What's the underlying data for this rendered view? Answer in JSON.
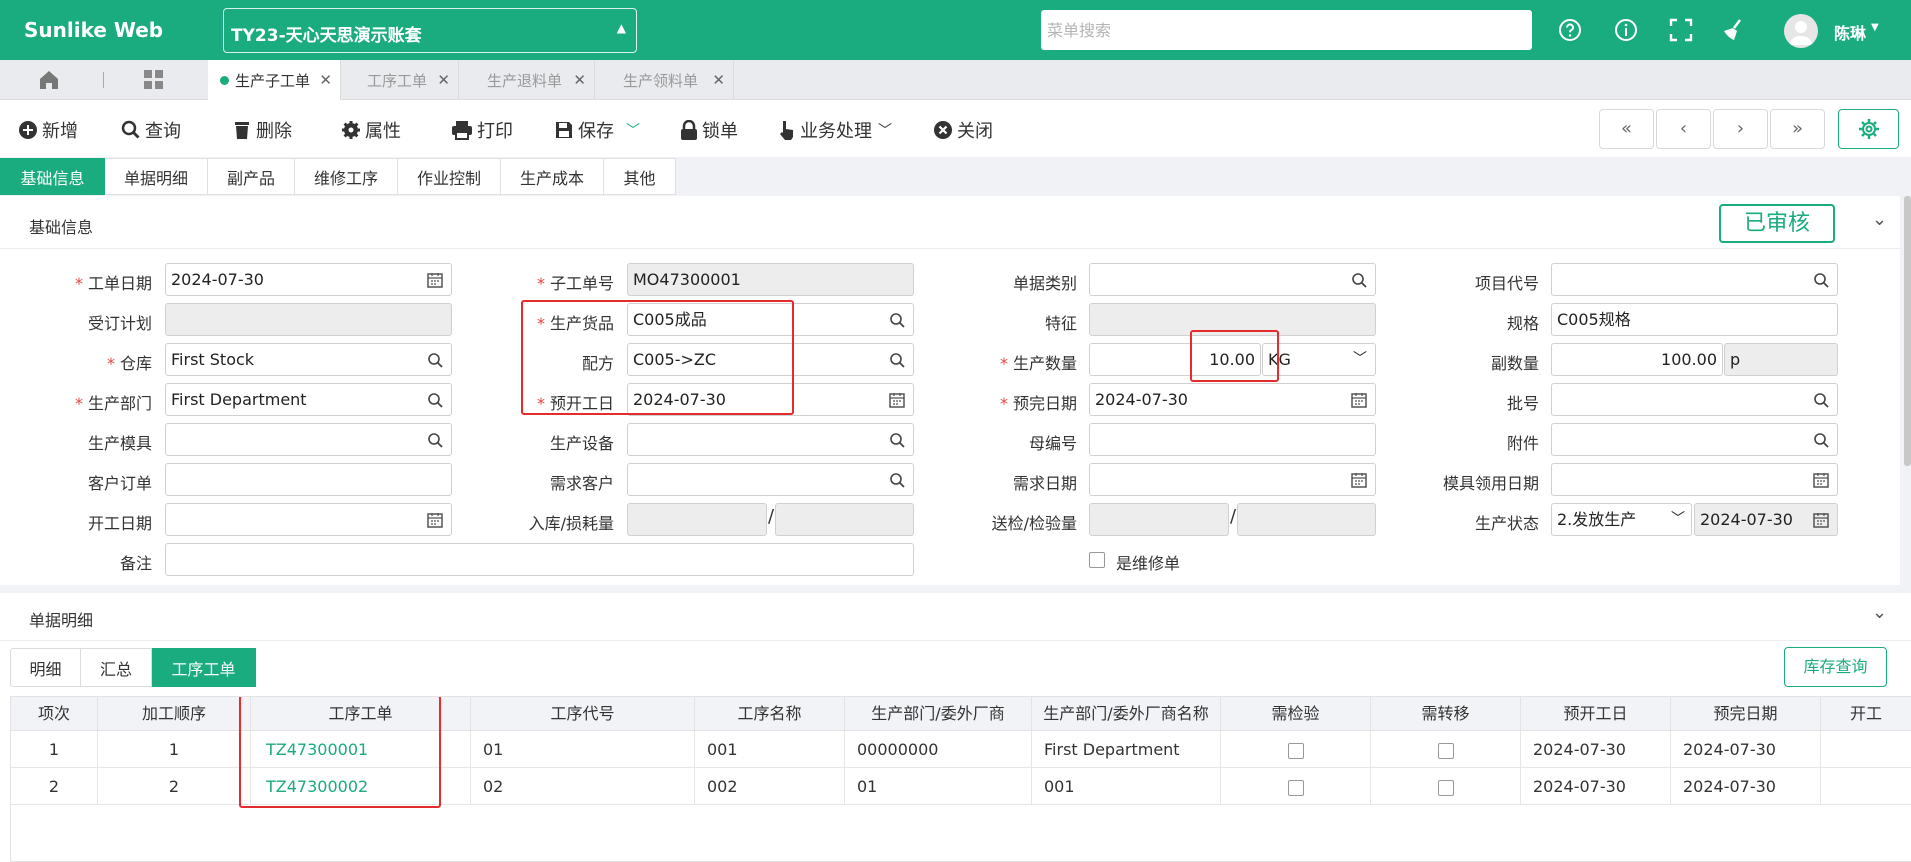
{
  "app": {
    "title": "Sunlike Web",
    "account": "TY23-天心天思演示账套",
    "menu_search_placeholder": "菜单搜索",
    "user": "陈琳"
  },
  "topbar_icons": [
    "help-icon",
    "info-icon",
    "fullscreen-icon",
    "clean-icon"
  ],
  "doc_tabs": [
    {
      "label": "生产子工单",
      "active": true
    },
    {
      "label": "工序工单",
      "active": false
    },
    {
      "label": "生产退料单",
      "active": false
    },
    {
      "label": "生产领料单",
      "active": false
    }
  ],
  "toolbar": {
    "add": "新增",
    "query": "查询",
    "delete": "删除",
    "props": "属性",
    "print": "打印",
    "save": "保存",
    "lock": "锁单",
    "business": "业务处理",
    "close": "关闭"
  },
  "section_tabs": [
    "基础信息",
    "单据明细",
    "副产品",
    "维修工序",
    "作业控制",
    "生产成本",
    "其他"
  ],
  "basic": {
    "header": "基础信息",
    "status_stamp": "已审核",
    "labels": {
      "order_date": "工单日期",
      "order_plan": "受订计划",
      "warehouse": "仓库",
      "dept": "生产部门",
      "mold": "生产模具",
      "customer_order": "客户订单",
      "start_date": "开工日期",
      "remark": "备注",
      "sub_order_no": "子工单号",
      "product": "生产货品",
      "recipe": "配方",
      "plan_start": "预开工日",
      "equipment": "生产设备",
      "demand_customer": "需求客户",
      "in_loss_qty": "入库/损耗量",
      "doc_type": "单据类别",
      "feature": "特征",
      "prod_qty": "生产数量",
      "plan_end": "预完日期",
      "mother_no": "母编号",
      "demand_date": "需求日期",
      "inspect_qty": "送检/检验量",
      "is_repair": "是维修单",
      "project_code": "项目代号",
      "spec": "规格",
      "sub_qty": "副数量",
      "batch_no": "批号",
      "attachment": "附件",
      "mold_use_date": "模具领用日期",
      "prod_status": "生产状态"
    },
    "values": {
      "order_date": "2024-07-30",
      "warehouse": "First Stock",
      "dept": "First Department",
      "sub_order_no": "MO47300001",
      "product": "C005成品",
      "recipe": "C005->ZC",
      "plan_start": "2024-07-30",
      "prod_qty": "10.00",
      "unit": "KG",
      "plan_end": "2024-07-30",
      "spec": "C005规格",
      "sub_qty": "100.00",
      "sub_unit": "p",
      "prod_status": "2.发放生产",
      "status_date": "2024-07-30"
    }
  },
  "detail": {
    "header": "单据明细",
    "sub_tabs": [
      {
        "label": "明细",
        "active": false
      },
      {
        "label": "汇总",
        "active": false
      },
      {
        "label": "工序工单",
        "active": true
      }
    ],
    "stock_query": "库存查询",
    "columns": [
      "项次",
      "加工顺序",
      "工序工单",
      "工序代号",
      "工序名称",
      "生产部门/委外厂商",
      "生产部门/委外厂商名称",
      "需检验",
      "需转移",
      "预开工日",
      "预完日期",
      "开工"
    ],
    "rows": [
      {
        "seq": "1",
        "order": "1",
        "wo": "TZ47300001",
        "code": "01",
        "name": "001",
        "dept": "00000000",
        "dept_name": "First Department",
        "inspect": false,
        "transfer": false,
        "start": "2024-07-30",
        "end": "2024-07-30"
      },
      {
        "seq": "2",
        "order": "2",
        "wo": "TZ47300002",
        "code": "02",
        "name": "002",
        "dept": "01",
        "dept_name": "001",
        "inspect": false,
        "transfer": false,
        "start": "2024-07-30",
        "end": "2024-07-30"
      }
    ]
  },
  "colors": {
    "brand": "#1aab7e",
    "highlight": "#e52b2b",
    "required": "#e54545"
  }
}
